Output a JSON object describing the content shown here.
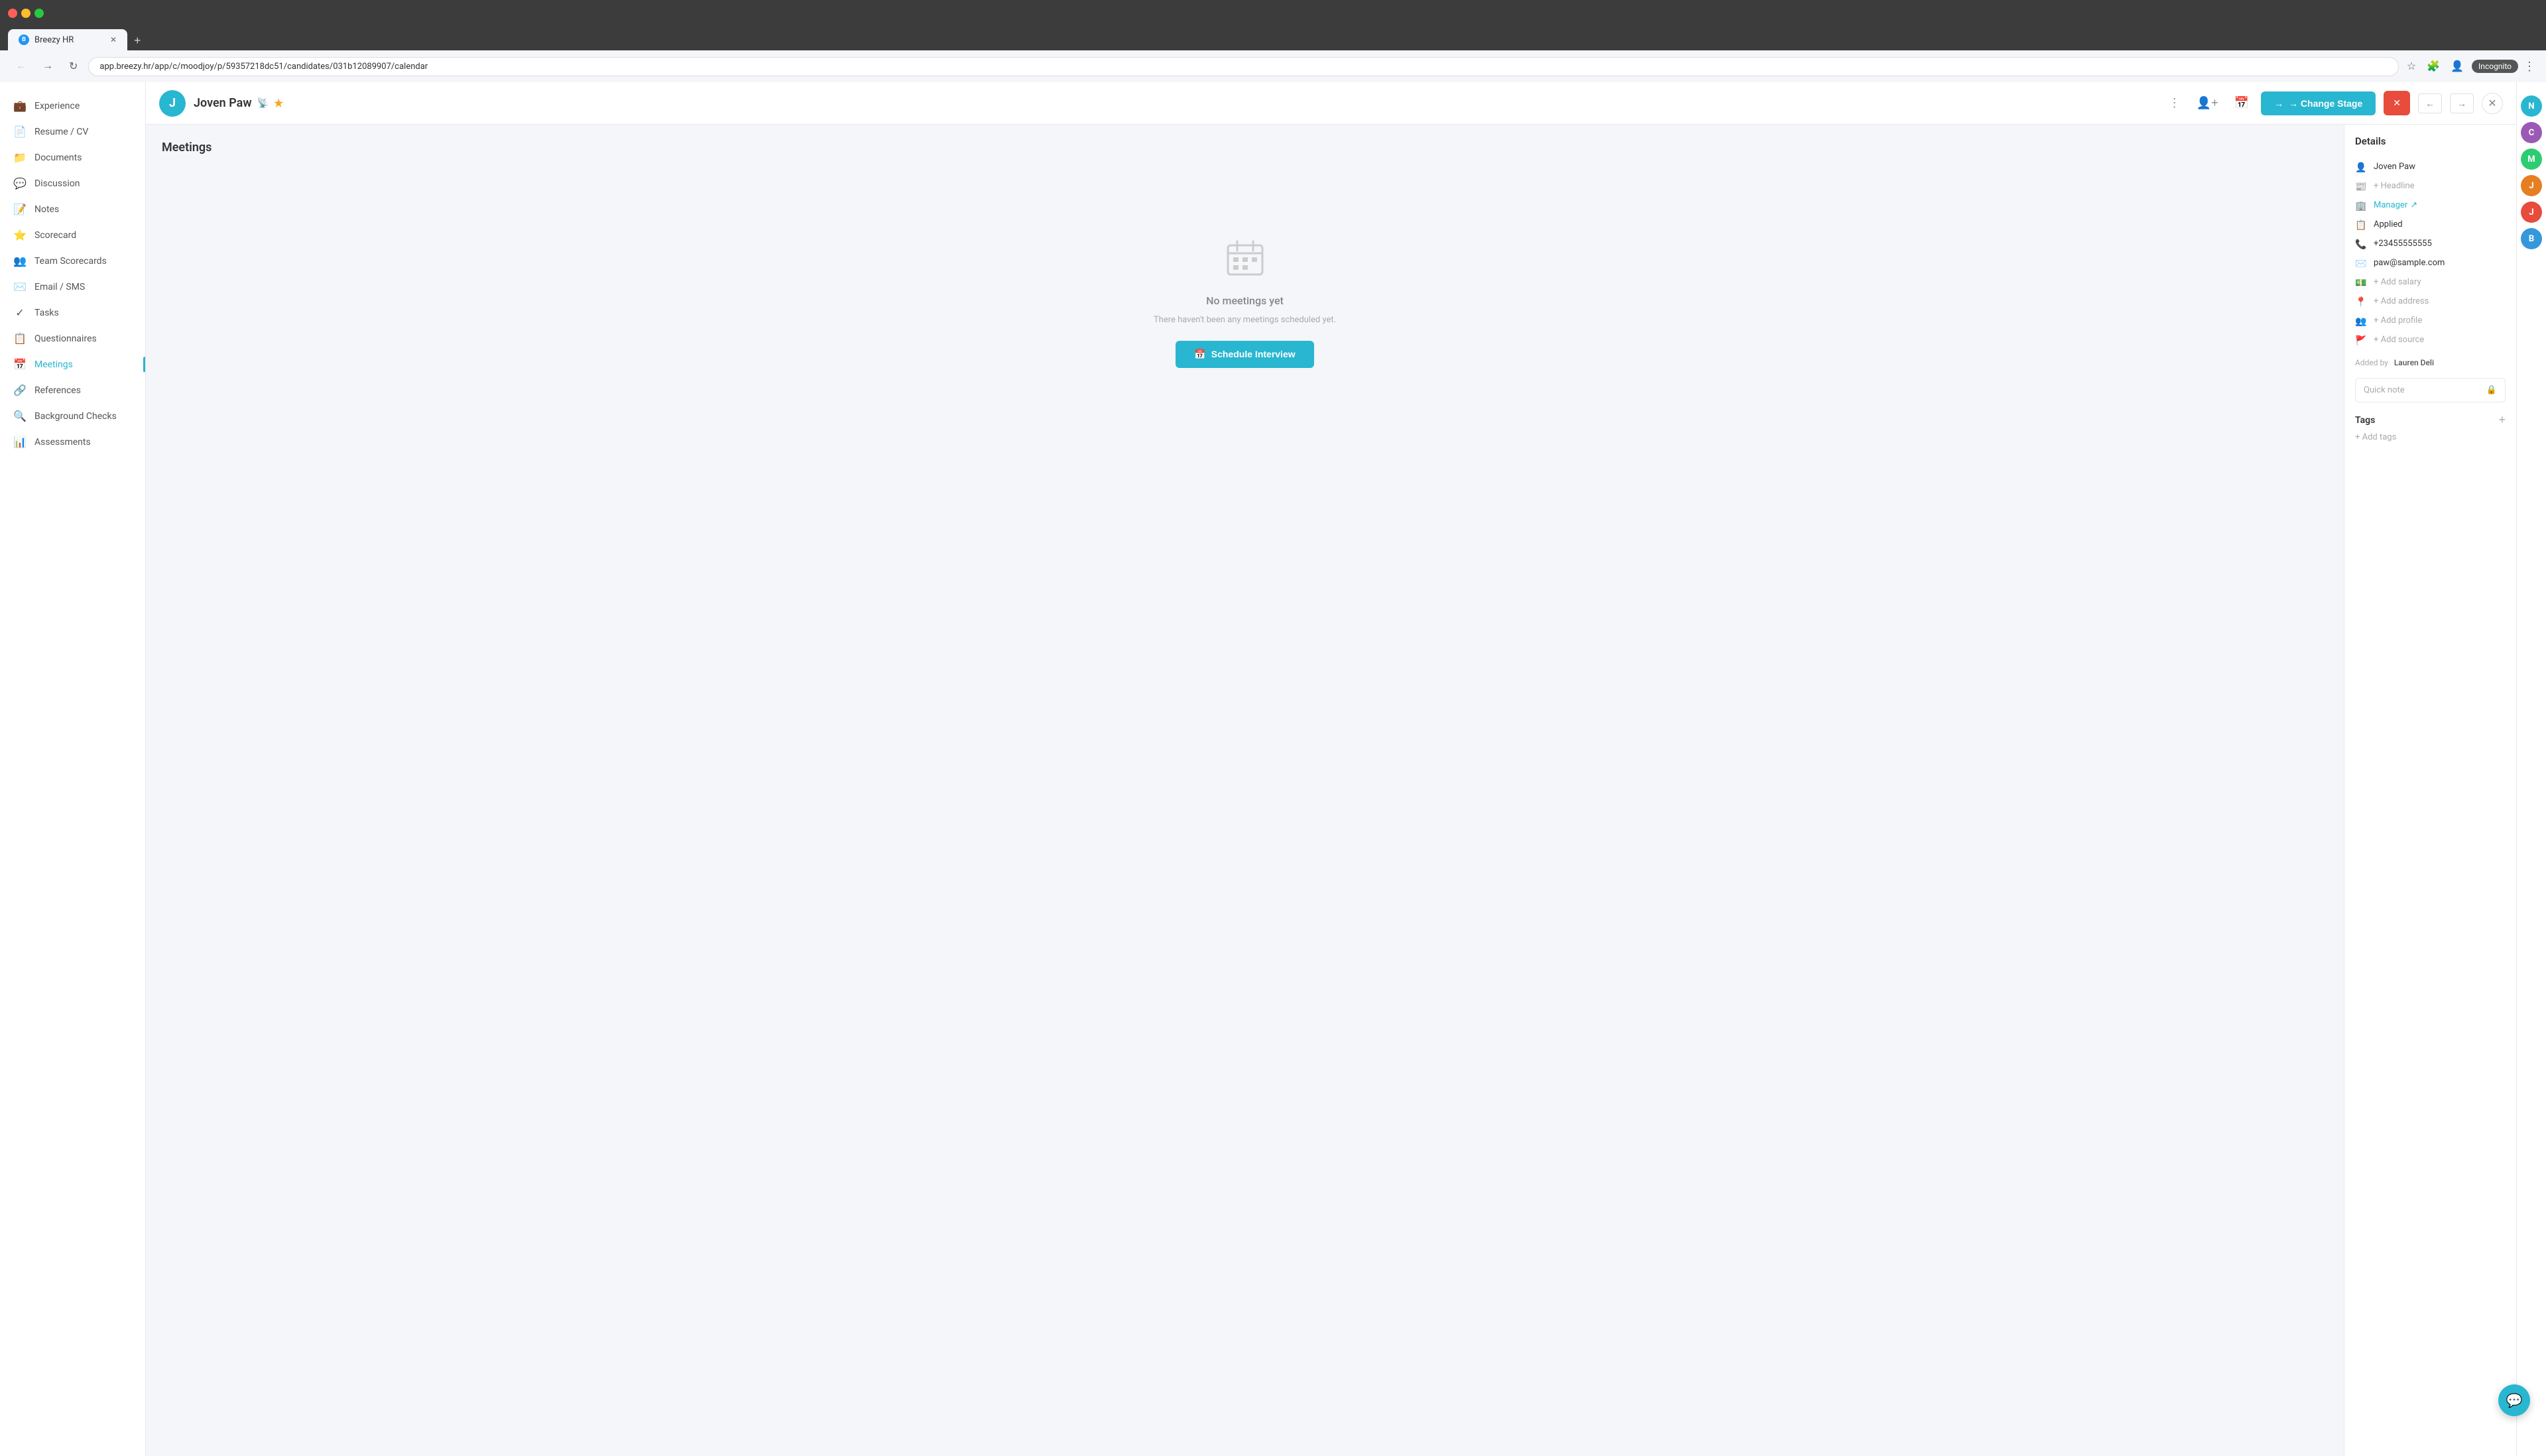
{
  "browser": {
    "tab_label": "Breezy HR",
    "tab_favicon": "B",
    "url": "app.breezy.hr/app/c/moodjoy/p/59357218dc51/candidates/031b12089907/calendar",
    "new_tab_label": "+",
    "incognito_text": "Incognito"
  },
  "header": {
    "candidate_initial": "J",
    "candidate_name": "Joven Paw",
    "rss_icon": "📡",
    "star_icon": "★",
    "change_stage_label": "→ Change Stage",
    "disqualify_icon": "✕",
    "nav_prev": "←",
    "nav_next": "→",
    "close_icon": "✕"
  },
  "sidebar": {
    "items": [
      {
        "id": "experience",
        "label": "Experience",
        "icon": "💼"
      },
      {
        "id": "resume-cv",
        "label": "Resume / CV",
        "icon": "📄"
      },
      {
        "id": "documents",
        "label": "Documents",
        "icon": "📁"
      },
      {
        "id": "discussion",
        "label": "Discussion",
        "icon": "💬"
      },
      {
        "id": "notes",
        "label": "Notes",
        "icon": "📝"
      },
      {
        "id": "scorecard",
        "label": "Scorecard",
        "icon": "⭐"
      },
      {
        "id": "team-scorecards",
        "label": "Team Scorecards",
        "icon": "👥"
      },
      {
        "id": "email-sms",
        "label": "Email / SMS",
        "icon": "✉️"
      },
      {
        "id": "tasks",
        "label": "Tasks",
        "icon": "✓"
      },
      {
        "id": "questionnaires",
        "label": "Questionnaires",
        "icon": "📋"
      },
      {
        "id": "meetings",
        "label": "Meetings",
        "icon": "📅",
        "active": true
      },
      {
        "id": "references",
        "label": "References",
        "icon": "🔗"
      },
      {
        "id": "background-checks",
        "label": "Background Checks",
        "icon": "🔍"
      },
      {
        "id": "assessments",
        "label": "Assessments",
        "icon": "📊"
      }
    ]
  },
  "main": {
    "title": "Meetings",
    "empty_state": {
      "icon": "📅",
      "title": "No meetings yet",
      "subtitle": "There haven't been any meetings scheduled yet.",
      "schedule_btn_label": "📅 Schedule Interview"
    }
  },
  "details": {
    "title": "Details",
    "candidate_name": "Joven Paw",
    "headline_placeholder": "+ Headline",
    "manager_label": "Manager",
    "manager_link_icon": "↗",
    "applied_label": "Applied",
    "phone": "+23455555555",
    "email": "paw@sample.com",
    "salary_placeholder": "+ Add salary",
    "address_placeholder": "+ Add address",
    "profile_placeholder": "+ Add profile",
    "source_placeholder": "+ Add source",
    "added_by_label": "Added by",
    "added_by_name": "Lauren Deli",
    "quick_note_placeholder": "Quick note",
    "lock_icon": "🔒",
    "tags_label": "Tags",
    "add_tags_label": "+ Add tags",
    "add_tags_btn": "+"
  },
  "right_panel": {
    "avatars": [
      {
        "id": "n-avatar",
        "initial": "N",
        "color": "#29b6d0"
      },
      {
        "id": "c-avatar",
        "initial": "C",
        "color": "#9b59b6"
      },
      {
        "id": "m-avatar",
        "initial": "M",
        "color": "#2ecc71"
      },
      {
        "id": "j-avatar-top",
        "initial": "J",
        "color": "#e67e22"
      },
      {
        "id": "j-avatar-bottom",
        "initial": "J",
        "color": "#e74c3c"
      },
      {
        "id": "b-avatar",
        "initial": "B",
        "color": "#3498db"
      }
    ]
  },
  "chat": {
    "icon": "💬"
  }
}
